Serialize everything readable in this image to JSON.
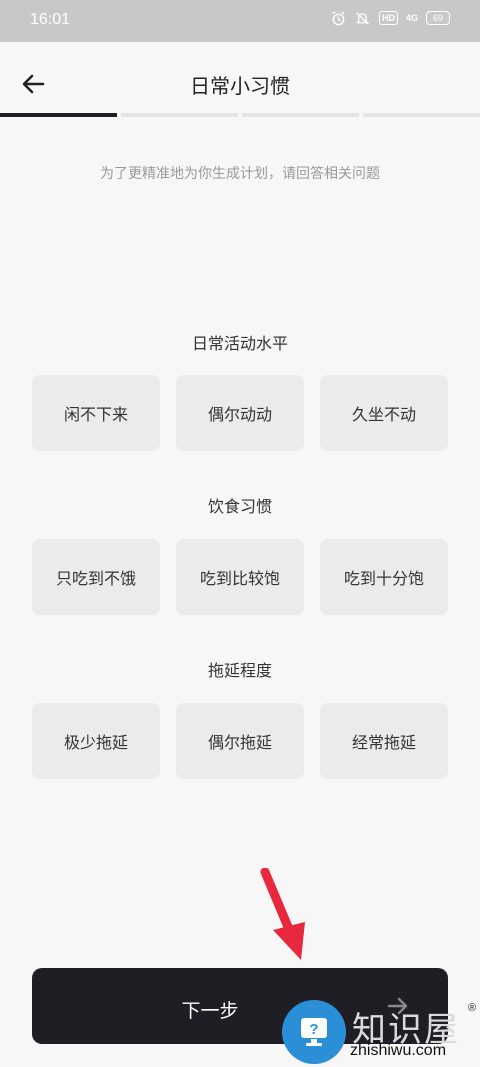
{
  "status_bar": {
    "time": "16:01",
    "icons": [
      "alarm-icon",
      "mute-icon",
      "hd-badge",
      "signal-icon",
      "battery-icon"
    ],
    "hd": "HD",
    "signal": "4G",
    "battery": "69"
  },
  "header": {
    "title": "日常小习惯",
    "back_icon": "arrow-left-icon"
  },
  "progress": {
    "steps": 4,
    "current": 1,
    "active_color": "#1f1f25"
  },
  "subtitle": "为了更精准地为你生成计划，请回答相关问题",
  "sections": [
    {
      "title": "日常活动水平",
      "options": [
        "闲不下来",
        "偶尔动动",
        "久坐不动"
      ]
    },
    {
      "title": "饮食习惯",
      "options": [
        "只吃到不饿",
        "吃到比较饱",
        "吃到十分饱"
      ]
    },
    {
      "title": "拖延程度",
      "options": [
        "极少拖延",
        "偶尔拖延",
        "经常拖延"
      ]
    }
  ],
  "next_button": {
    "label": "下一步",
    "icon": "arrow-right-icon",
    "color": "#1e1e24"
  },
  "annotation": {
    "icon": "red-arrow-icon",
    "color": "#e8283c"
  },
  "watermark": {
    "text_cn": "知识屋",
    "text_en": "zhishiwu.com",
    "mark": "®",
    "logo_icon": "question-monitor-icon"
  }
}
